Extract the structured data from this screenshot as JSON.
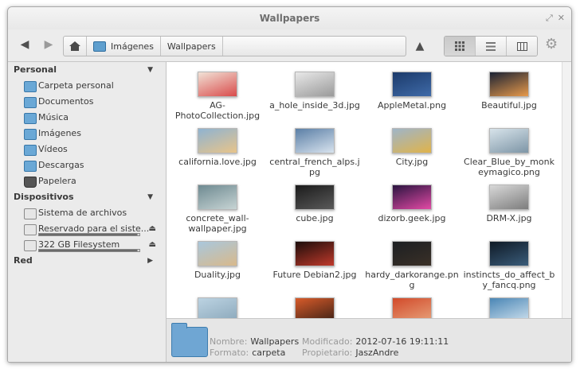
{
  "window": {
    "title": "Wallpapers"
  },
  "toolbar": {
    "back_icon": "arrow-left-icon",
    "forward_icon": "arrow-right-icon",
    "home_icon": "home-icon",
    "breadcrumbs": [
      "Imágenes",
      "Wallpapers"
    ],
    "up_icon": "arrow-up-icon",
    "view_modes": [
      "icon-view",
      "list-view",
      "column-view"
    ],
    "active_view": "icon-view"
  },
  "sidebar": {
    "personal": {
      "title": "Personal",
      "items": [
        "Carpeta personal",
        "Documentos",
        "Música",
        "Imágenes",
        "Vídeos",
        "Descargas",
        "Papelera"
      ]
    },
    "devices": {
      "title": "Dispositivos",
      "items": [
        "Sistema de archivos",
        "Reservado para el siste...",
        "322 GB Filesystem"
      ],
      "usage": [
        null,
        0.98,
        0.98
      ]
    },
    "network": {
      "title": "Red"
    }
  },
  "files": [
    {
      "name": "AG-PhotoCollection.jpg",
      "colors": [
        "#f1e2d6",
        "#d94b4b"
      ]
    },
    {
      "name": "a_hole_inside_3d.jpg",
      "colors": [
        "#e8e8e8",
        "#9a9a9a"
      ]
    },
    {
      "name": "AppleMetal.png",
      "colors": [
        "#1b3a6a",
        "#3f6aa8"
      ]
    },
    {
      "name": "Beautiful.jpg",
      "colors": [
        "#1a2233",
        "#e89a4b"
      ]
    },
    {
      "name": "california.love.jpg",
      "colors": [
        "#8fb3d1",
        "#e8c48a"
      ]
    },
    {
      "name": "central_french_alps.jpg",
      "colors": [
        "#5b7fa6",
        "#d8e3ee"
      ]
    },
    {
      "name": "City.jpg",
      "colors": [
        "#9fb5c8",
        "#e0b34a"
      ]
    },
    {
      "name": "Clear_Blue_by_monkeymagico.png",
      "colors": [
        "#d7e3ea",
        "#7d95a6"
      ]
    },
    {
      "name": "concrete_wall-wallpaper.jpg",
      "colors": [
        "#6e8a91",
        "#c7d4d4"
      ]
    },
    {
      "name": "cube.jpg",
      "colors": [
        "#1b1b1b",
        "#5a5a5a"
      ]
    },
    {
      "name": "dizorb.geek.jpg",
      "colors": [
        "#2a1440",
        "#e24aa5"
      ]
    },
    {
      "name": "DRM-X.jpg",
      "colors": [
        "#d8d8d8",
        "#7d7d7d"
      ]
    },
    {
      "name": "Duality.jpg",
      "colors": [
        "#a9c7dc",
        "#d8b98b"
      ]
    },
    {
      "name": "Future Debian2.jpg",
      "colors": [
        "#1c0d0a",
        "#c0392b"
      ]
    },
    {
      "name": "hardy_darkorange.png",
      "colors": [
        "#1c1f22",
        "#3a3027"
      ]
    },
    {
      "name": "instincts_do_affect_by_fancq.png",
      "colors": [
        "#0f1a26",
        "#3a5c7a"
      ]
    },
    {
      "name": "",
      "colors": [
        "#bcd3e2",
        "#8aa7ba"
      ]
    },
    {
      "name": "",
      "colors": [
        "#d85b2a",
        "#3c2015"
      ]
    },
    {
      "name": "",
      "colors": [
        "#d24a2a",
        "#e7a27b"
      ]
    },
    {
      "name": "",
      "colors": [
        "#4a86b5",
        "#cfe1ee"
      ]
    }
  ],
  "status": {
    "name_label": "Nombre:",
    "name_value": "Wallpapers",
    "format_label": "Formato:",
    "format_value": "carpeta",
    "modified_label": "Modificado:",
    "modified_value": "2012-07-16 19:11:11",
    "owner_label": "Propietario:",
    "owner_value": "JaszAndre"
  }
}
